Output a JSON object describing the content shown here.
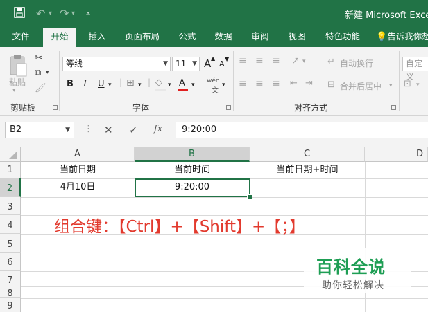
{
  "titlebar": {
    "title": "新建 Microsoft Excel",
    "save_icon": "save-icon",
    "undo_icon": "undo-icon",
    "redo_icon": "redo-icon",
    "customize_icon": "customize-qat-icon"
  },
  "tabs": [
    "文件",
    "开始",
    "插入",
    "页面布局",
    "公式",
    "数据",
    "审阅",
    "视图",
    "特色功能",
    "告诉我你想"
  ],
  "active_tab": "开始",
  "ribbon": {
    "clipboard": {
      "paste": "粘贴",
      "label": "剪贴板"
    },
    "font": {
      "name": "等线",
      "size": "11",
      "grow": "A",
      "shrink": "A",
      "bold": "B",
      "italic": "I",
      "underline": "U",
      "font_color": "A",
      "wen": "wén",
      "label": "字体"
    },
    "alignment": {
      "wrap": "自动换行",
      "merge": "合并后居中",
      "label": "对齐方式"
    },
    "number": {
      "format": "自定义"
    }
  },
  "formula_bar": {
    "name_box": "B2",
    "cancel": "✕",
    "enter": "✓",
    "fx": "fx",
    "value": "9:20:00"
  },
  "columns": [
    "A",
    "B",
    "C",
    "D"
  ],
  "selected_column": "B",
  "rows": [
    "1",
    "2",
    "3",
    "4",
    "5",
    "6",
    "7",
    "8",
    "9"
  ],
  "selected_row": "2",
  "cells": {
    "A1": "当前日期",
    "B1": "当前时间",
    "C1": "当前日期+时间",
    "A2": "4月10日",
    "B2": "9:20:00"
  },
  "annotation": "组合键：【Ctrl】+【Shift】+【；】",
  "watermark": {
    "title": "百科全说",
    "subtitle": "助你轻松解决"
  },
  "colors": {
    "excel_green": "#217346",
    "annotation_red": "#e23a2e",
    "watermark_green": "#1e9e54"
  }
}
